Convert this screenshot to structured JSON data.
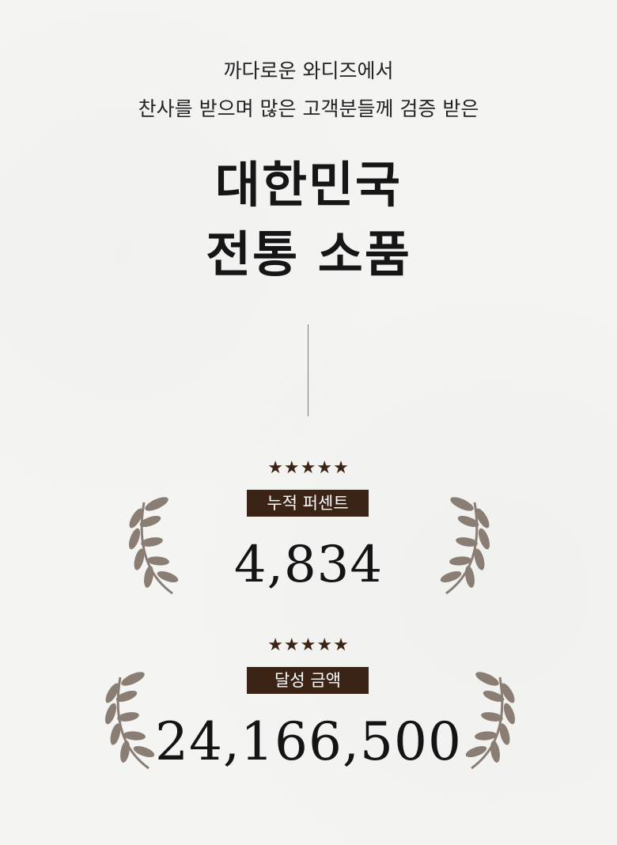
{
  "intro": {
    "line1": "까다로운 와디즈에서",
    "line2": "찬사를 받으며 많은 고객분들께 검증 받은"
  },
  "headline": {
    "line1": "대한민국",
    "line2": "전통 소품"
  },
  "stats": [
    {
      "stars": "★★★★★",
      "rating": 5,
      "label": "누적 퍼센트",
      "value": "4,834"
    },
    {
      "stars": "★★★★★",
      "rating": 5,
      "label": "달성 금액",
      "value": "24,166,500"
    }
  ],
  "colors": {
    "background": "#f4f4f2",
    "badge": "#3b2416",
    "stars": "#3a2416",
    "laurel": "#8a7e74",
    "divider": "#8a7466"
  },
  "icons": {
    "laurel": "laurel-branch-icon",
    "star": "star-icon"
  }
}
